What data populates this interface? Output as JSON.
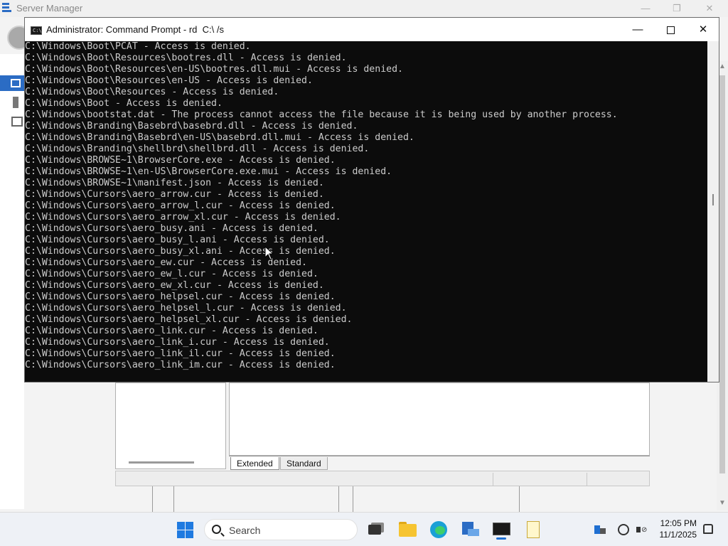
{
  "server_manager": {
    "title": "Server Manager",
    "controls": {
      "minimize": "—",
      "restore": "❐",
      "close": "✕"
    },
    "tabs": [
      {
        "label": "Extended"
      },
      {
        "label": "Standard"
      }
    ]
  },
  "cmd": {
    "title": "Administrator: Command Prompt - rd  C:\\ /s",
    "controls": {
      "minimize": "—",
      "close": "✕"
    },
    "lines": [
      "C:\\Windows\\Boot\\PCAT - Access is denied.",
      "C:\\Windows\\Boot\\Resources\\bootres.dll - Access is denied.",
      "C:\\Windows\\Boot\\Resources\\en-US\\bootres.dll.mui - Access is denied.",
      "C:\\Windows\\Boot\\Resources\\en-US - Access is denied.",
      "C:\\Windows\\Boot\\Resources - Access is denied.",
      "C:\\Windows\\Boot - Access is denied.",
      "C:\\Windows\\bootstat.dat - The process cannot access the file because it is being used by another process.",
      "C:\\Windows\\Branding\\Basebrd\\basebrd.dll - Access is denied.",
      "C:\\Windows\\Branding\\Basebrd\\en-US\\basebrd.dll.mui - Access is denied.",
      "C:\\Windows\\Branding\\shellbrd\\shellbrd.dll - Access is denied.",
      "C:\\Windows\\BROWSE~1\\BrowserCore.exe - Access is denied.",
      "C:\\Windows\\BROWSE~1\\en-US\\BrowserCore.exe.mui - Access is denied.",
      "C:\\Windows\\BROWSE~1\\manifest.json - Access is denied.",
      "C:\\Windows\\Cursors\\aero_arrow.cur - Access is denied.",
      "C:\\Windows\\Cursors\\aero_arrow_l.cur - Access is denied.",
      "C:\\Windows\\Cursors\\aero_arrow_xl.cur - Access is denied.",
      "C:\\Windows\\Cursors\\aero_busy.ani - Access is denied.",
      "C:\\Windows\\Cursors\\aero_busy_l.ani - Access is denied.",
      "C:\\Windows\\Cursors\\aero_busy_xl.ani - Access is denied.",
      "C:\\Windows\\Cursors\\aero_ew.cur - Access is denied.",
      "C:\\Windows\\Cursors\\aero_ew_l.cur - Access is denied.",
      "C:\\Windows\\Cursors\\aero_ew_xl.cur - Access is denied.",
      "C:\\Windows\\Cursors\\aero_helpsel.cur - Access is denied.",
      "C:\\Windows\\Cursors\\aero_helpsel_l.cur - Access is denied.",
      "C:\\Windows\\Cursors\\aero_helpsel_xl.cur - Access is denied.",
      "C:\\Windows\\Cursors\\aero_link.cur - Access is denied.",
      "C:\\Windows\\Cursors\\aero_link_i.cur - Access is denied.",
      "C:\\Windows\\Cursors\\aero_link_il.cur - Access is denied.",
      "C:\\Windows\\Cursors\\aero_link_im.cur - Access is denied."
    ]
  },
  "taskbar": {
    "search_label": "Search",
    "time": "12:05 PM",
    "date": "11/1/2025",
    "apps": [
      "task-view",
      "file-explorer",
      "edge",
      "server-manager",
      "command-prompt",
      "notepad"
    ]
  },
  "colors": {
    "console_bg": "#0c0c0c",
    "console_text": "#cccccc",
    "accent": "#1f6fd1"
  }
}
